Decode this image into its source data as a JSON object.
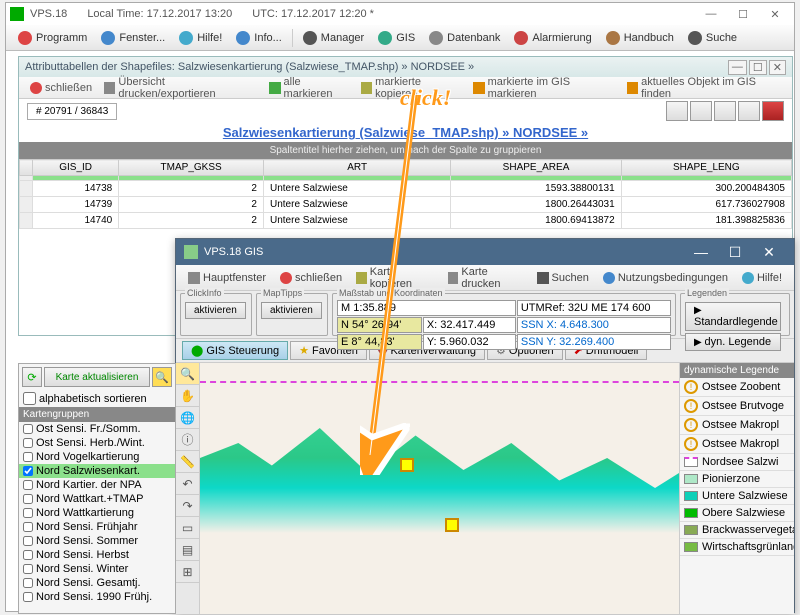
{
  "main": {
    "title": "VPS.18",
    "local_time_label": "Local Time: 17.12.2017 13:20",
    "utc_label": "UTC: 17.12.2017 12:20  *",
    "menu": [
      "Programm",
      "Fenster...",
      "Hilfe!",
      "Info...",
      "Manager",
      "GIS",
      "Datenbank",
      "Alarmierung",
      "Handbuch",
      "Suche"
    ]
  },
  "attr": {
    "title": "Attributtabellen der Shapefiles: Salzwiesenkartierung (Salzwiese_TMAP.shp) » NORDSEE »",
    "toolbar": [
      "schließen",
      "Übersicht drucken/exportieren",
      "alle markieren",
      "markierte kopieren",
      "markierte im GIS markieren",
      "aktuelles Objekt im GIS finden"
    ],
    "count": "# 20791 / 36843",
    "grid_title": "Salzwiesenkartierung (Salzwiese_TMAP.shp) » NORDSEE »",
    "grid_sub": "Spaltentitel hierher ziehen, um nach der Spalte zu gruppieren",
    "columns": [
      "GIS_ID",
      "TMAP_GKSS",
      "ART",
      "SHAPE_AREA",
      "SHAPE_LENG"
    ],
    "rows": [
      {
        "sel": true,
        "cells": [
          "",
          "",
          "",
          "",
          ""
        ]
      },
      {
        "cells": [
          "14738",
          "2",
          "Untere Salzwiese",
          "1593.38800131",
          "300.200484305"
        ]
      },
      {
        "cells": [
          "14739",
          "2",
          "Untere Salzwiese",
          "1800.26443031",
          "617.736027908"
        ]
      },
      {
        "cells": [
          "14740",
          "2",
          "Untere Salzwiese",
          "1800.69413872",
          "181.398825836"
        ]
      }
    ]
  },
  "gis": {
    "title": "VPS.18  GIS",
    "toolbar": [
      "Hauptfenster",
      "schließen",
      "Karte kopieren",
      "Karte drucken",
      "Suchen",
      "Nutzungsbedingungen",
      "Hilfe!"
    ],
    "panels": {
      "clickinfo": {
        "label": "ClickInfo",
        "btn": "aktivieren"
      },
      "maptipps": {
        "label": "MapTipps",
        "btn": "aktivieren"
      },
      "coords": {
        "label": "Maßstab und Koordinaten",
        "scale": "M 1:35.889",
        "utmref": "UTMRef: 32U ME 174 600",
        "n_lab": "N 54° 26,94'",
        "n_x": "X: 32.417.449",
        "n_ssn": "SSN X: 4.648.300",
        "e_lab": "E 8° 44,83'",
        "e_y": "Y: 5.960.032",
        "e_ssn": "SSN Y: 32.269.400"
      },
      "legenden": {
        "label": "Legenden",
        "std": "Standardlegende",
        "dyn": "dyn. Legende"
      }
    },
    "tabs": [
      "GIS Steuerung",
      "Favoriten",
      "Kartenverwaltung",
      "Optionen",
      "Driftmodell"
    ],
    "layers": {
      "refresh": "Karte aktualisieren",
      "sort": "alphabetisch sortieren",
      "header": "Kartengruppen",
      "items": [
        {
          "label": "Ost Sensi. Fr./Somm."
        },
        {
          "label": "Ost Sensi. Herb./Wint."
        },
        {
          "label": "Nord Vogelkartierung"
        },
        {
          "label": "Nord Salzwiesenkart.",
          "checked": true,
          "sel": true
        },
        {
          "label": "Nord Kartier. der NPA"
        },
        {
          "label": "Nord Wattkart.+TMAP"
        },
        {
          "label": "Nord Wattkartierung"
        },
        {
          "label": "Nord Sensi. Frühjahr"
        },
        {
          "label": "Nord Sensi. Sommer"
        },
        {
          "label": "Nord Sensi. Herbst"
        },
        {
          "label": "Nord Sensi. Winter"
        },
        {
          "label": "Nord Sensi. Gesamtj."
        },
        {
          "label": "Nord Sensi. 1990 Frühj."
        }
      ]
    },
    "legend": {
      "header": "dynamische Legende",
      "items": [
        {
          "type": "sym",
          "color": "#d90",
          "label": "Ostsee Zoobent"
        },
        {
          "type": "sym",
          "color": "#d90",
          "label": "Ostsee Brutvoge"
        },
        {
          "type": "sym",
          "color": "#d90",
          "label": "Ostsee Makropl"
        },
        {
          "type": "sym",
          "color": "#d90",
          "label": "Ostsee Makropl"
        },
        {
          "type": "line",
          "color": "#d4d",
          "label": "Nordsee Salzwi"
        },
        {
          "type": "sw",
          "color": "#aee8c8",
          "label": "Pionierzone"
        },
        {
          "type": "sw",
          "color": "#0dd0b8",
          "label": "Untere Salzwiese"
        },
        {
          "type": "sw",
          "color": "#0b0",
          "label": "Obere Salzwiese"
        },
        {
          "type": "sw",
          "color": "#8a5",
          "label": "Brackwasservegetati"
        },
        {
          "type": "sw",
          "color": "#7b4",
          "label": "Wirtschaftsgrünland"
        }
      ]
    }
  },
  "overlay": {
    "click": "click!"
  }
}
